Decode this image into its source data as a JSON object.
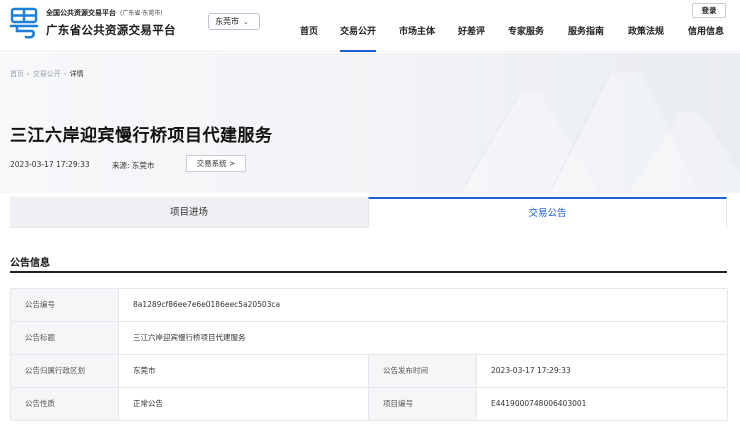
{
  "header": {
    "brand_small": "全国公共资源交易平台",
    "brand_small_sub": "(广东省·东莞市)",
    "brand_big": "广东省公共资源交易平台",
    "city": "东莞市",
    "login": "登录",
    "nav": [
      {
        "label": "首页",
        "active": false
      },
      {
        "label": "交易公开",
        "active": true
      },
      {
        "label": "市场主体",
        "active": false
      },
      {
        "label": "好差评",
        "active": false
      },
      {
        "label": "专家服务",
        "active": false
      },
      {
        "label": "服务指南",
        "active": false
      },
      {
        "label": "政策法规",
        "active": false
      },
      {
        "label": "信用信息",
        "active": false
      }
    ]
  },
  "breadcrumb": {
    "home": "首页",
    "section": "交易公开",
    "current": "详情"
  },
  "page": {
    "title": "三江六岸迎宾慢行桥项目代建服务",
    "date": "2023-03-17 17:29:33",
    "source": "来源: 东莞市",
    "system_button": "交易系统 >"
  },
  "tabs": [
    {
      "label": "项目进场",
      "active": false
    },
    {
      "label": "交易公告",
      "active": true
    }
  ],
  "section": {
    "title": "公告信息"
  },
  "info": {
    "notice_no_label": "公告编号",
    "notice_no": "8a1289cf86ee7e6e0186eec5a20503ca",
    "notice_title_label": "公告标题",
    "notice_title": "三江六岸迎宾慢行桥项目代建服务",
    "region_label": "公告归属行政区划",
    "region": "东莞市",
    "publish_time_label": "公告发布时间",
    "publish_time": "2023-03-17 17:29:33",
    "nature_label": "公告性质",
    "nature": "正常公告",
    "project_no_label": "项目编号",
    "project_no": "E4419000748006403001"
  }
}
